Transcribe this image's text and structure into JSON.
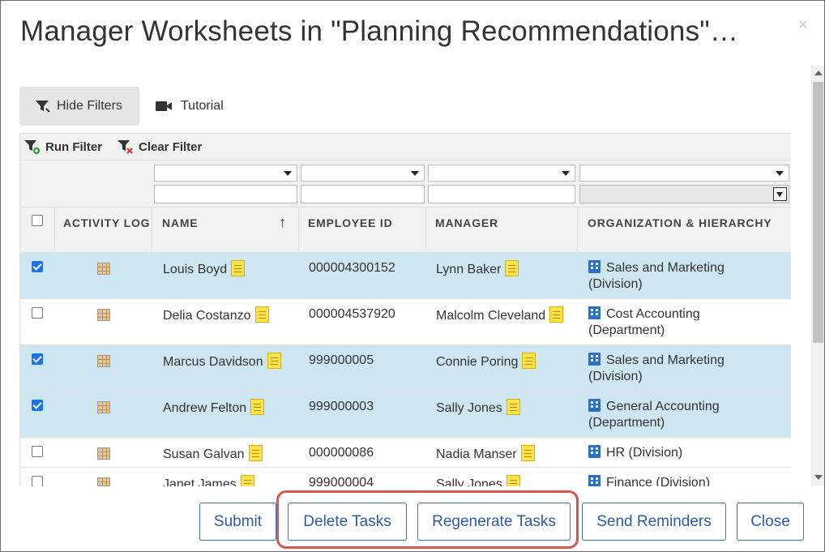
{
  "dialog": {
    "title": "Manager Worksheets in \"Planning Recommendations\"…",
    "close_glyph": "×"
  },
  "toolbar": {
    "hide_filters": "Hide Filters",
    "tutorial": "Tutorial"
  },
  "filter_bar": {
    "run_filter": "Run Filter",
    "clear_filter": "Clear Filter"
  },
  "columns": {
    "activity_log": "ACTIVITY LOG",
    "name": "NAME",
    "employee_id": "EMPLOYEE ID",
    "manager": "MANAGER",
    "organization": "ORGANIZATION & HIERARCHY",
    "sort_glyph": "↑"
  },
  "rows": [
    {
      "checked": true,
      "name": "Louis Boyd",
      "employee_id": "000004300152",
      "manager": "Lynn Baker",
      "org_line1": "Sales and Marketing",
      "org_line2": "(Division)"
    },
    {
      "checked": false,
      "name": "Delia Costanzo",
      "employee_id": "000004537920",
      "manager": "Malcolm Cleveland",
      "org_line1": "Cost Accounting",
      "org_line2": "(Department)"
    },
    {
      "checked": true,
      "name": "Marcus Davidson",
      "employee_id": "999000005",
      "manager": "Connie Poring",
      "org_line1": "Sales and Marketing",
      "org_line2": "(Division)"
    },
    {
      "checked": true,
      "name": "Andrew Felton",
      "employee_id": "999000003",
      "manager": "Sally Jones",
      "org_line1": "General Accounting",
      "org_line2": "(Department)"
    },
    {
      "checked": false,
      "name": "Susan Galvan",
      "employee_id": "000000086",
      "manager": "Nadia Manser",
      "org_line1": "HR (Division)",
      "org_line2": ""
    },
    {
      "checked": false,
      "name": "Janet James",
      "employee_id": "999000004",
      "manager": "Sally Jones",
      "org_line1": "Finance (Division)",
      "org_line2": ""
    }
  ],
  "footer": {
    "submit": "Submit",
    "delete_tasks": "Delete Tasks",
    "regenerate_tasks": "Regenerate Tasks",
    "send_reminders": "Send Reminders",
    "close": "Close"
  },
  "colors": {
    "selected_row": "#cde6f2",
    "accent": "#2a5caa",
    "highlight": "#d9534f"
  },
  "icons": {
    "hide_filters": "filter-icon",
    "tutorial": "video-camera-icon",
    "run_filter": "filter-add-icon",
    "clear_filter": "filter-clear-icon",
    "activity_log": "activity-log-icon",
    "note": "note-icon",
    "organization": "building-icon"
  }
}
